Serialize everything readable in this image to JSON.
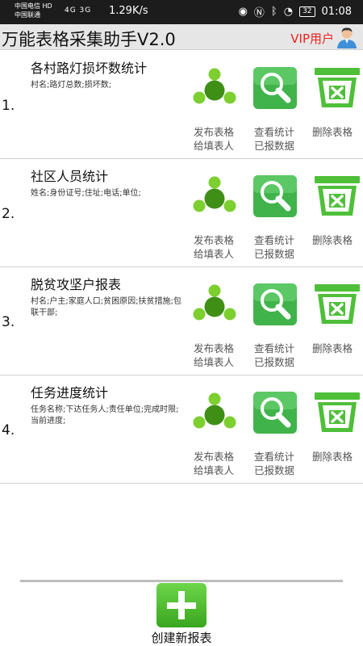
{
  "status_bar": {
    "carrier_line1": "中国电信 HD",
    "carrier_line2": "中国联通",
    "signal_text": "4G  3G",
    "net_speed": "1.29K/s",
    "battery": "32",
    "time": "01:08"
  },
  "header": {
    "title": "万能表格采集助手V2.0",
    "vip_label": "VIP用户"
  },
  "forms": [
    {
      "index": "1.",
      "title": "各村路灯损坏数统计",
      "fields": "村名;路灯总数;损坏数;"
    },
    {
      "index": "2.",
      "title": "社区人员统计",
      "fields": "姓名;身份证号;住址;电话;单位;"
    },
    {
      "index": "3.",
      "title": "脱贫攻坚户报表",
      "fields": "村名;户主;家庭人口;贫困原因;扶贫措施;包联干部;"
    },
    {
      "index": "4.",
      "title": "任务进度统计",
      "fields": "任务名称;下达任务人;责任单位;完成时限;当前进度;"
    }
  ],
  "actions": {
    "publish_line1": "发布表格",
    "publish_line2": "给填表人",
    "view_line1": "查看统计",
    "view_line2": "已报数据",
    "delete": "删除表格"
  },
  "icons": {
    "publish": "share-dots-icon",
    "view": "magnifier-icon",
    "delete": "trash-box-icon",
    "create": "plus-icon",
    "avatar": "user-avatar-icon"
  },
  "footer": {
    "create_label": "创建新报表"
  },
  "colors": {
    "accent_green": "#3aa51f",
    "vip_red": "#e8221b"
  }
}
